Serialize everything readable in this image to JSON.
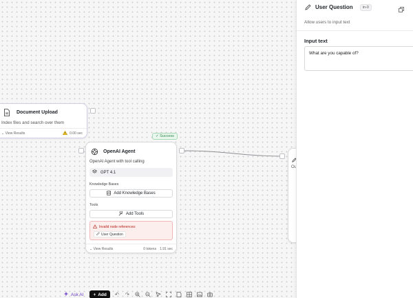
{
  "doc_node": {
    "title": "Document Upload",
    "description": "Index files and search over them",
    "view_results": "View Results",
    "time": "0.00 sec"
  },
  "agent_node": {
    "status": "✓ Success",
    "title": "OpenAI Agent",
    "description": "OpenAI Agent with tool calling",
    "model": "GPT 4.1",
    "kb_label": "Knowledge Bases",
    "kb_button": "Add Knowledge Bases",
    "tools_label": "Tools",
    "tools_button": "Add Tools",
    "error_title": "Invalid node references:",
    "error_ref": "User Question",
    "view_results": "View Results",
    "tokens": "0 tokens",
    "time": "1.91 sec"
  },
  "partial_node": {
    "label": "Ou"
  },
  "panel": {
    "title": "User Question",
    "node_id": "in-0",
    "description": "Allow users to input text",
    "input_label": "Input text",
    "input_value": "What are you capable of?"
  },
  "toolbar": {
    "ask_ai": "Ask AI",
    "add": "Add"
  },
  "colors": {
    "accent_purple": "#6a3fc6",
    "success_green": "#2d8a48",
    "error_red": "#b42318"
  }
}
